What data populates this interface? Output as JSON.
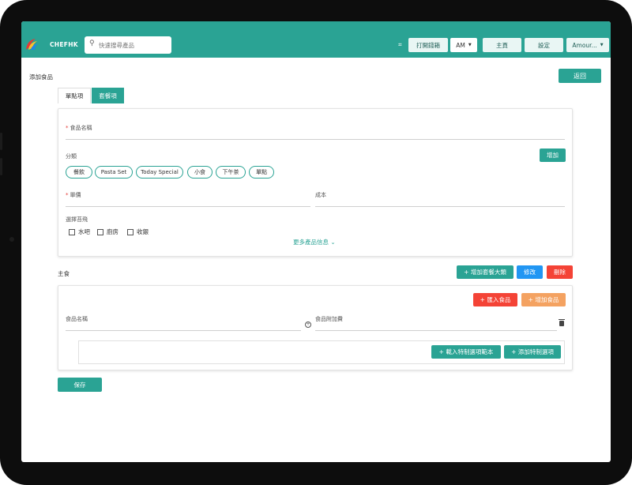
{
  "header": {
    "brand": "CHEFHK",
    "search_placeholder": "快速搜尋產品",
    "open_drawer_label": "打開錢箱",
    "am_label": "AM",
    "home_label": "主頁",
    "settings_label": "設定",
    "user_label": "Amour..."
  },
  "page": {
    "title": "添加食品",
    "back_label": "返回"
  },
  "tabs": [
    {
      "label": "單點項"
    },
    {
      "label": "套餐項"
    }
  ],
  "form": {
    "food_name_label": "食品名稱",
    "category_label": "分類",
    "add_label": "增加",
    "categories": [
      "餐飲",
      "Pasta Set",
      "Today Special",
      "小食",
      "下午茶",
      "單點"
    ],
    "unit_price_label": "單價",
    "cost_label": "成本",
    "printer_label": "選擇苔飛",
    "printers": [
      "水吧",
      "廚房",
      "收銀"
    ],
    "more_info_label": "更多產品信息 ⌄"
  },
  "main_section": {
    "label": "主食",
    "add_group_label": "+ 增加套餐大類",
    "edit_label": "修改",
    "delete_label": "刪除",
    "import_food_label": "+ 匯入食品",
    "add_food_label": "+ 增加食品",
    "food_name_label": "食品名稱",
    "food_surcharge_label": "食品附加費",
    "import_template_label": "+ 載入特制選項範本",
    "add_custom_label": "+ 添加特制選項"
  },
  "save_label": "保存",
  "colors": {
    "accent": "#2aa394",
    "blue": "#2196f3",
    "red": "#f44336",
    "orange": "#f4a261"
  }
}
